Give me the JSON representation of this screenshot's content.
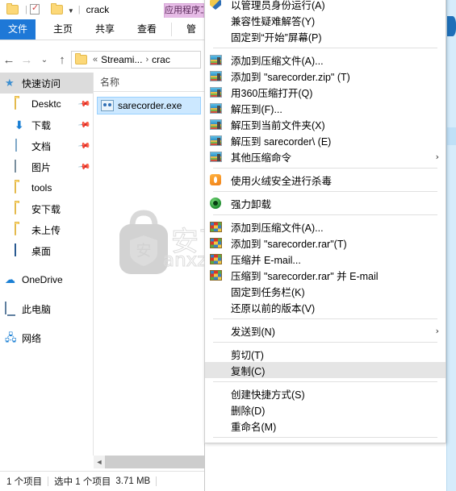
{
  "window": {
    "title": "crack",
    "contextual_tab": "应用程序工具",
    "quick_access_icons": [
      "folder-icon",
      "properties-icon",
      "new-folder-icon",
      "dropdown-caret-icon"
    ]
  },
  "ribbon": {
    "tabs": [
      {
        "label": "文件",
        "active": true
      },
      {
        "label": "主页",
        "active": false
      },
      {
        "label": "共享",
        "active": false
      },
      {
        "label": "查看",
        "active": false
      },
      {
        "label": "管",
        "active": false
      }
    ]
  },
  "addressbar": {
    "back": "←",
    "forward": "→",
    "recent": "⌄",
    "up": "↑",
    "crumb_prefix": "«",
    "segments": [
      "Streami...",
      "crac"
    ],
    "separator": "›"
  },
  "navpane": {
    "items": [
      {
        "label": "快速访问",
        "icon": "star-icon",
        "selected": true,
        "indent": false,
        "pinned": false
      },
      {
        "label": "Desktc",
        "icon": "folder-icon",
        "selected": false,
        "indent": true,
        "pinned": true
      },
      {
        "label": "下载",
        "icon": "download-icon",
        "selected": false,
        "indent": true,
        "pinned": true
      },
      {
        "label": "文档",
        "icon": "document-icon",
        "selected": false,
        "indent": true,
        "pinned": true
      },
      {
        "label": "图片",
        "icon": "pictures-icon",
        "selected": false,
        "indent": true,
        "pinned": true
      },
      {
        "label": "tools",
        "icon": "folder-icon",
        "selected": false,
        "indent": true,
        "pinned": false
      },
      {
        "label": "安下载",
        "icon": "folder-icon",
        "selected": false,
        "indent": true,
        "pinned": false
      },
      {
        "label": "未上传",
        "icon": "folder-icon",
        "selected": false,
        "indent": true,
        "pinned": false
      },
      {
        "label": "桌面",
        "icon": "desktop-icon",
        "selected": false,
        "indent": true,
        "pinned": false
      },
      {
        "label": "OneDrive",
        "icon": "cloud-icon",
        "selected": false,
        "indent": false,
        "pinned": false
      },
      {
        "label": "此电脑",
        "icon": "this-pc-icon",
        "selected": false,
        "indent": false,
        "pinned": false
      },
      {
        "label": "网络",
        "icon": "network-icon",
        "selected": false,
        "indent": false,
        "pinned": false
      }
    ]
  },
  "filelist": {
    "column_header": "名称",
    "rows": [
      {
        "name": "sarecorder.exe",
        "icon": "exe-icon",
        "selected": true
      }
    ]
  },
  "statusbar": {
    "item_count": "1 个项目",
    "selection": "选中 1 个项目",
    "size": "3.71 MB"
  },
  "contextmenu": {
    "items": [
      {
        "label": "以管理员身份运行(A)",
        "icon": "shield-icon",
        "sep_after": false,
        "highlight": false,
        "submenu": false
      },
      {
        "label": "兼容性疑难解答(Y)",
        "icon": "",
        "sep_after": false,
        "highlight": false,
        "submenu": false
      },
      {
        "label": "固定到“开始”屏幕(P)",
        "icon": "",
        "sep_after": true,
        "highlight": false,
        "submenu": false
      },
      {
        "label": "添加到压缩文件(A)...",
        "icon": "zip360-icon",
        "sep_after": false,
        "highlight": false,
        "submenu": false
      },
      {
        "label": "添加到 \"sarecorder.zip\" (T)",
        "icon": "zip360-icon",
        "sep_after": false,
        "highlight": false,
        "submenu": false
      },
      {
        "label": "用360压缩打开(Q)",
        "icon": "zip360-icon",
        "sep_after": false,
        "highlight": false,
        "submenu": false
      },
      {
        "label": "解压到(F)...",
        "icon": "zip360-icon",
        "sep_after": false,
        "highlight": false,
        "submenu": false
      },
      {
        "label": "解压到当前文件夹(X)",
        "icon": "zip360-icon",
        "sep_after": false,
        "highlight": false,
        "submenu": false
      },
      {
        "label": "解压到 sarecorder\\ (E)",
        "icon": "zip360-icon",
        "sep_after": false,
        "highlight": false,
        "submenu": false
      },
      {
        "label": "其他压缩命令",
        "icon": "zip360-icon",
        "sep_after": true,
        "highlight": false,
        "submenu": true
      },
      {
        "label": "使用火绒安全进行杀毒",
        "icon": "huorong-icon",
        "sep_after": true,
        "highlight": false,
        "submenu": false
      },
      {
        "label": "强力卸载",
        "icon": "uninstall-icon",
        "sep_after": true,
        "highlight": false,
        "submenu": false
      },
      {
        "label": "添加到压缩文件(A)...",
        "icon": "winrar-icon",
        "sep_after": false,
        "highlight": false,
        "submenu": false
      },
      {
        "label": "添加到 \"sarecorder.rar\"(T)",
        "icon": "winrar-icon",
        "sep_after": false,
        "highlight": false,
        "submenu": false
      },
      {
        "label": "压缩并 E-mail...",
        "icon": "winrar-icon",
        "sep_after": false,
        "highlight": false,
        "submenu": false
      },
      {
        "label": "压缩到 \"sarecorder.rar\" 并 E-mail",
        "icon": "winrar-icon",
        "sep_after": false,
        "highlight": false,
        "submenu": false
      },
      {
        "label": "固定到任务栏(K)",
        "icon": "",
        "sep_after": false,
        "highlight": false,
        "submenu": false
      },
      {
        "label": "还原以前的版本(V)",
        "icon": "",
        "sep_after": true,
        "highlight": false,
        "submenu": false
      },
      {
        "label": "发送到(N)",
        "icon": "",
        "sep_after": true,
        "highlight": false,
        "submenu": true
      },
      {
        "label": "剪切(T)",
        "icon": "",
        "sep_after": false,
        "highlight": false,
        "submenu": false
      },
      {
        "label": "复制(C)",
        "icon": "",
        "sep_after": true,
        "highlight": true,
        "submenu": false
      },
      {
        "label": "创建快捷方式(S)",
        "icon": "",
        "sep_after": false,
        "highlight": false,
        "submenu": false
      },
      {
        "label": "删除(D)",
        "icon": "",
        "sep_after": false,
        "highlight": false,
        "submenu": false
      },
      {
        "label": "重命名(M)",
        "icon": "",
        "sep_after": true,
        "highlight": false,
        "submenu": false
      }
    ]
  },
  "watermark": {
    "glyph": "安",
    "text": "安下载",
    "subtext": "anxz.com"
  },
  "colors": {
    "accent": "#1e78d7",
    "selection": "#cce8ff",
    "menu_highlight": "#e5e5e5",
    "contextual_tab": "#e6bbe6"
  }
}
